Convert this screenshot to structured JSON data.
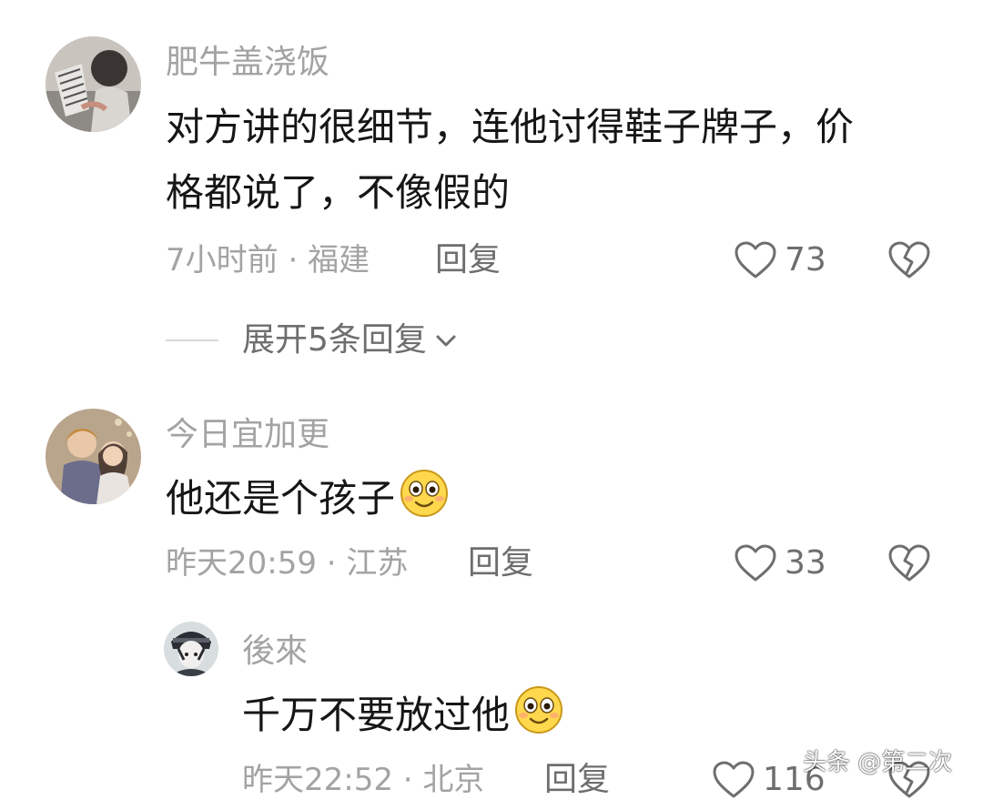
{
  "comments": [
    {
      "username": "肥牛盖浇饭",
      "text_lines": [
        "对方讲的很细节，连他讨得鞋子牌子，价",
        "格都说了，不像假的"
      ],
      "time": "7小时前",
      "separator": "·",
      "location": "福建",
      "reply_label": "回复",
      "likes": "73",
      "avatar_icon": "user-avatar-fan",
      "expand_label": "展开5条回复"
    },
    {
      "username": "今日宜加更",
      "text": "他还是个孩子",
      "emoji": "smiling-emoji",
      "time": "昨天20:59",
      "separator": "·",
      "location": "江苏",
      "reply_label": "回复",
      "likes": "33",
      "avatar_icon": "user-avatar-couple"
    }
  ],
  "reply": {
    "username": "後來",
    "text": "千万不要放过他",
    "emoji": "smiling-emoji",
    "time": "昨天22:52",
    "separator": "·",
    "location": "北京",
    "reply_label": "回复",
    "likes": "116",
    "avatar_icon": "user-avatar-anime"
  },
  "watermark": "头条 @第二次",
  "colors": {
    "text_primary": "#161616",
    "text_muted": "#a3a3a3",
    "text_action": "#6e6e6e",
    "emoji_face": "#ffd84d"
  }
}
